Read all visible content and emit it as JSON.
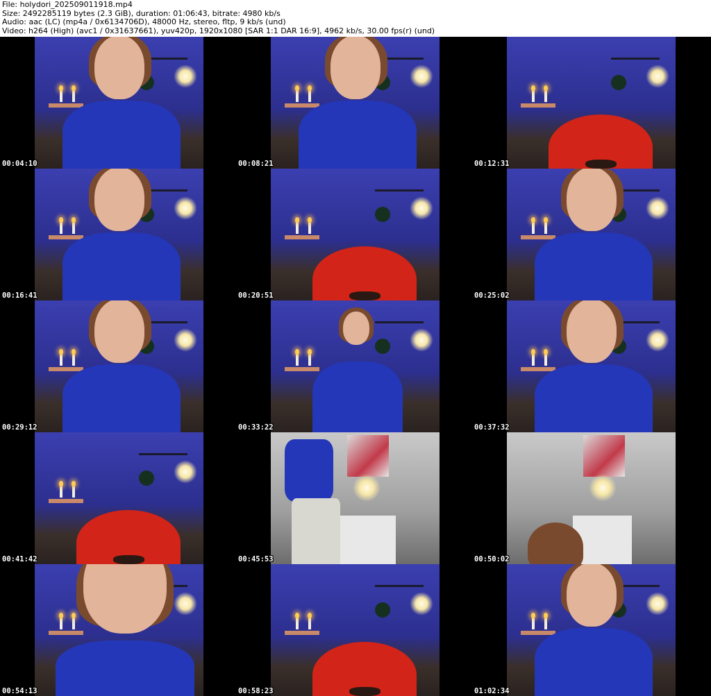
{
  "header": {
    "line1": "File: holydori_202509011918.mp4",
    "line2": "Size: 2492285119 bytes (2.3 GiB), duration: 01:06:43, bitrate: 4980 kb/s",
    "line3": "Audio: aac (LC) (mp4a / 0x6134706D), 48000 Hz, stereo, fltp, 9 kb/s (und)",
    "line4": "Video: h264 (High) (avc1 / 0x31637661), yuv420p, 1920x1080 [SAR 1:1 DAR 16:9], 4962 kb/s, 30.00 fps(r) (und)"
  },
  "thumbnails": [
    {
      "time": "00:04:10",
      "scene": "person"
    },
    {
      "time": "00:08:21",
      "scene": "person"
    },
    {
      "time": "00:12:31",
      "scene": "chair"
    },
    {
      "time": "00:16:41",
      "scene": "person"
    },
    {
      "time": "00:20:51",
      "scene": "chair"
    },
    {
      "time": "00:25:02",
      "scene": "person"
    },
    {
      "time": "00:29:12",
      "scene": "person"
    },
    {
      "time": "00:33:22",
      "scene": "person-far"
    },
    {
      "time": "00:37:32",
      "scene": "person"
    },
    {
      "time": "00:41:42",
      "scene": "chair"
    },
    {
      "time": "00:45:53",
      "scene": "bathroom"
    },
    {
      "time": "00:50:02",
      "scene": "bathroom"
    },
    {
      "time": "00:54:13",
      "scene": "person-close"
    },
    {
      "time": "00:58:23",
      "scene": "chair"
    },
    {
      "time": "01:02:34",
      "scene": "person"
    }
  ]
}
